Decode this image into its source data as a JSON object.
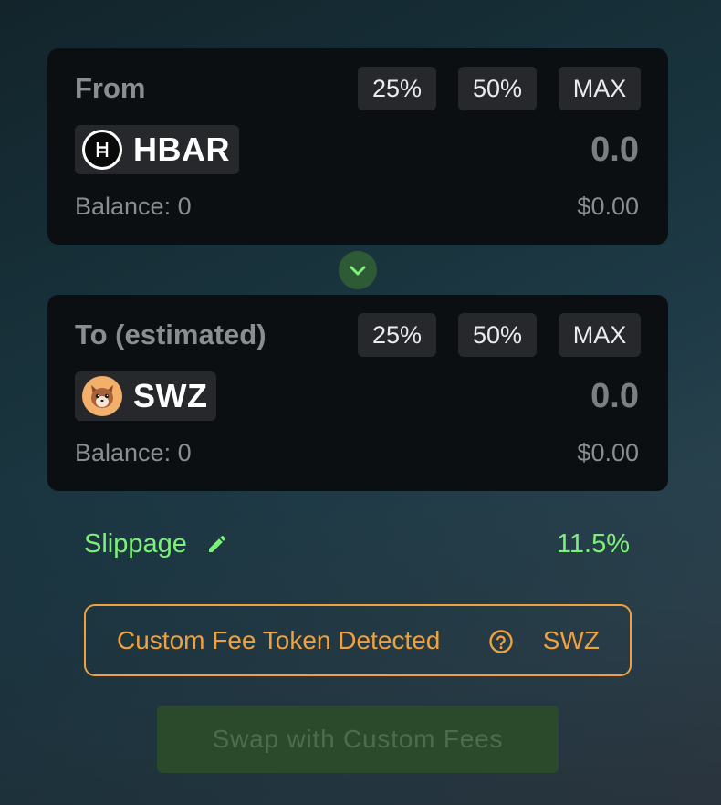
{
  "from_card": {
    "label": "From",
    "percent_buttons": [
      "25%",
      "50%",
      "MAX"
    ],
    "token": {
      "name": "HBAR",
      "icon": "hbar-logo-icon"
    },
    "amount": "0.0",
    "balance": "Balance: 0",
    "usd_value": "$0.00"
  },
  "switch": {
    "icon": "chevron-down-icon",
    "color": "#2f5a36"
  },
  "to_card": {
    "label": "To (estimated)",
    "percent_buttons": [
      "25%",
      "50%",
      "MAX"
    ],
    "token": {
      "name": "SWZ",
      "icon": "swz-fox-logo-icon"
    },
    "amount": "0.0",
    "balance": "Balance: 0",
    "usd_value": "$0.00"
  },
  "slippage": {
    "label": "Slippage",
    "edit_icon": "pencil-icon",
    "value": "11.5%",
    "color": "#7ef07a"
  },
  "fee_notice": {
    "text": "Custom Fee Token Detected",
    "help_icon": "question-circle-icon",
    "token": "SWZ",
    "color": "#f0a03c"
  },
  "swap_button": {
    "label": "Swap with Custom Fees",
    "state": "disabled"
  }
}
